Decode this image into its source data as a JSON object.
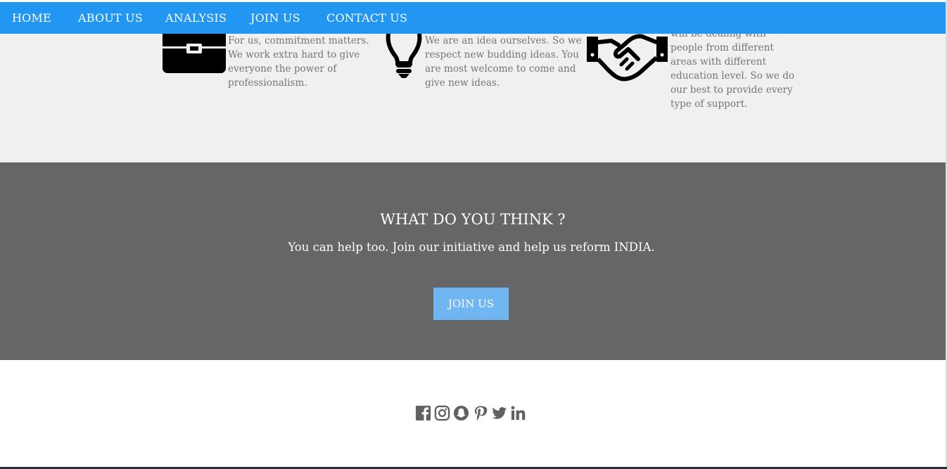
{
  "nav": {
    "items": [
      {
        "label": "HOME"
      },
      {
        "label": "ABOUT US"
      },
      {
        "label": "ANALYSIS"
      },
      {
        "label": "JOIN US"
      },
      {
        "label": "CONTACT US"
      }
    ]
  },
  "features": [
    {
      "icon": "briefcase-icon",
      "text_lines": [
        "For us, commitment matters.",
        "We work extra hard to give",
        "everyone the power of",
        "professionalism."
      ]
    },
    {
      "icon": "lightbulb-icon",
      "text_lines": [
        "We are an idea ourselves. So we",
        "respect new budding ideas. You",
        "are most welcome to come and",
        "give new ideas."
      ]
    },
    {
      "icon": "handshake-icon",
      "text_lines": [
        "will be dealing with",
        "people from different",
        "areas with different",
        "education level. So we do",
        "our best to provide every",
        "type of support."
      ]
    }
  ],
  "cta": {
    "title": "WHAT DO YOU THINK ?",
    "subtitle": "You can help too. Join our initiative and help us reform INDIA.",
    "button_label": "JOIN US"
  },
  "footer": {
    "social_icons": [
      "facebook-icon",
      "instagram-icon",
      "snapchat-icon",
      "pinterest-icon",
      "twitter-icon",
      "linkedin-icon"
    ]
  },
  "colors": {
    "nav_bg": "#2196f3",
    "features_bg": "#f0f0f0",
    "cta_bg": "#666666",
    "button_bg": "#6fb6f3",
    "icon_grey": "#616161"
  }
}
